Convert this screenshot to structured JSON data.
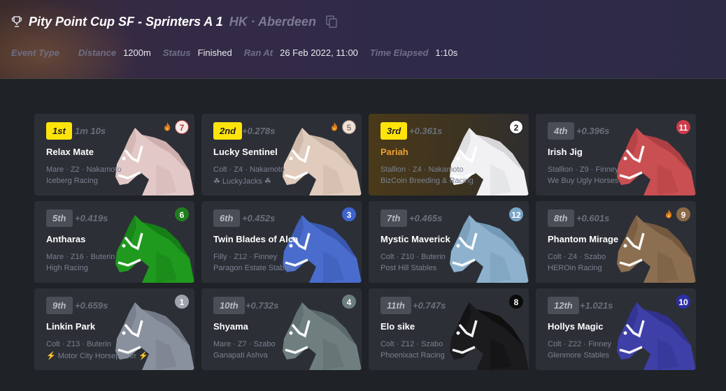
{
  "race": {
    "title": "Pity Point Cup SF - Sprinters A 1",
    "location": "HK · Aberdeen"
  },
  "meta": [
    {
      "label": "Event Type",
      "value": ""
    },
    {
      "label": "Distance",
      "value": "1200m"
    },
    {
      "label": "Status",
      "value": "Finished"
    },
    {
      "label": "Ran At",
      "value": "26 Feb 2022, 11:00"
    },
    {
      "label": "Time Elapsed",
      "value": "1:10s"
    }
  ],
  "colors": {
    "gold_badge": "#ffe40b",
    "pariah_name": "#f0a030"
  },
  "results": [
    {
      "position": "1st",
      "gap": "1m 10s",
      "gate": "7",
      "gate_bg": "#f6e9e6",
      "gate_fg": "#b33b3b",
      "gate_ring": "#b33b3b",
      "fire": true,
      "name": "Relax Mate",
      "info": "Mare · Z2 · Nakamoto",
      "owner": "Iceberg Racing",
      "coat": "#e2c9c8",
      "mane": "#caa9a8"
    },
    {
      "position": "2nd",
      "gap": "+0.278s",
      "gate": "5",
      "gate_bg": "#efe1d8",
      "gate_fg": "#9a7b6c",
      "gate_ring": "#9a7b6c",
      "fire": true,
      "name": "Lucky Sentinel",
      "info": "Colt · Z4 · Nakamoto",
      "owner": "☘ LuckyJacks ☘",
      "coat": "#e0cbbd",
      "mane": "#c3ac9c"
    },
    {
      "position": "3rd",
      "gap": "+0.361s",
      "gate": "2",
      "gate_bg": "#ffffff",
      "gate_fg": "#1d1d1d",
      "gate_ring": "#1d1d1d",
      "fire": false,
      "name": "Pariah",
      "info": "Stallion · Z4 · Nakamoto",
      "owner": "BizCoin Breeding & Racing",
      "coat": "#f1f1f3",
      "mane": "#cfd0d4"
    },
    {
      "position": "4th",
      "gap": "+0.396s",
      "gate": "11",
      "gate_bg": "#cf3d4a",
      "gate_fg": "#ffffff",
      "gate_ring": "#cf3d4a",
      "fire": false,
      "name": "Irish Jig",
      "info": "Stallion · Z9 · Finney",
      "owner": "We Buy Ugly Horses",
      "coat": "#c94f52",
      "mane": "#a83b3e"
    },
    {
      "position": "5th",
      "gap": "+0.419s",
      "gate": "6",
      "gate_bg": "#1f7d1f",
      "gate_fg": "#ffffff",
      "gate_ring": "#1f7d1f",
      "fire": false,
      "name": "Antharas",
      "info": "Mare · Z16 · Buterin",
      "owner": "High Racing",
      "coat": "#1f9a1f",
      "mane": "#157515"
    },
    {
      "position": "6th",
      "gap": "+0.452s",
      "gate": "3",
      "gate_bg": "#3f63cf",
      "gate_fg": "#ffffff",
      "gate_ring": "#3f63cf",
      "fire": false,
      "name": "Twin Blades of Alca",
      "info": "Filly · Z12 · Finney",
      "owner": "Paragon Estate Stables",
      "coat": "#4a6ccc",
      "mane": "#3553a8"
    },
    {
      "position": "7th",
      "gap": "+0.465s",
      "gate": "12",
      "gate_bg": "#7aa6c6",
      "gate_fg": "#ffffff",
      "gate_ring": "#7aa6c6",
      "fire": false,
      "name": "Mystic Maverick",
      "info": "Colt · Z10 · Buterin",
      "owner": "Post Hill Stables",
      "coat": "#8eb2cd",
      "mane": "#6d93b0"
    },
    {
      "position": "8th",
      "gap": "+0.601s",
      "gate": "9",
      "gate_bg": "#8c6a45",
      "gate_fg": "#ffffff",
      "gate_ring": "#8c6a45",
      "fire": true,
      "name": "Phantom Mirage",
      "info": "Colt · Z4 · Szabo",
      "owner": "HEROin Racing",
      "coat": "#8c6f50",
      "mane": "#6e543b"
    },
    {
      "position": "9th",
      "gap": "+0.659s",
      "gate": "1",
      "gate_bg": "#9ea3ad",
      "gate_fg": "#ffffff",
      "gate_ring": "#9ea3ad",
      "fire": false,
      "name": "Linkin Park",
      "info": "Colt · Z13 · Buterin",
      "owner": "⚡ Motor City Horsepower ⚡",
      "coat": "#8a919e",
      "mane": "#6d7480"
    },
    {
      "position": "10th",
      "gap": "+0.732s",
      "gate": "4",
      "gate_bg": "#6c7d7e",
      "gate_fg": "#ffffff",
      "gate_ring": "#6c7d7e",
      "fire": false,
      "name": "Shyama",
      "info": "Mare · Z7 · Szabo",
      "owner": "Ganapati Ashva",
      "coat": "#6f7f80",
      "mane": "#566465"
    },
    {
      "position": "11th",
      "gap": "+0.747s",
      "gate": "8",
      "gate_bg": "#0b0b0b",
      "gate_fg": "#ffffff",
      "gate_ring": "#0b0b0b",
      "fire": false,
      "name": "Elo sike",
      "info": "Colt · Z12 · Szabo",
      "owner": "Phoenixact Racing",
      "coat": "#1b1b1d",
      "mane": "#0c0c0d"
    },
    {
      "position": "12th",
      "gap": "+1.021s",
      "gate": "10",
      "gate_bg": "#2b2fa6",
      "gate_fg": "#ffffff",
      "gate_ring": "#2b2fa6",
      "fire": false,
      "name": "Hollys Magic",
      "info": "Colt · Z22 · Finney",
      "owner": "Glenmore Stables",
      "coat": "#3f3fa8",
      "mane": "#2e2e86"
    }
  ]
}
